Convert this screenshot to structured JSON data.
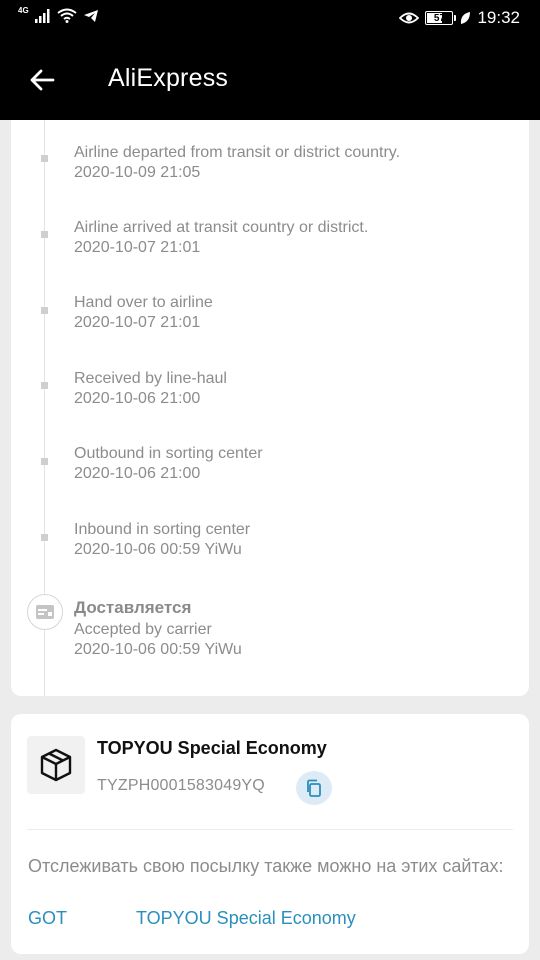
{
  "status_bar": {
    "network": "4G",
    "battery": "57",
    "time": "19:32"
  },
  "header": {
    "title": "AliExpress"
  },
  "tracking": {
    "events": [
      {
        "text": "Airline departed from transit or district country.",
        "date": "2020-10-09 21:05"
      },
      {
        "text": "Airline arrived at transit country or district.",
        "date": "2020-10-07 21:01"
      },
      {
        "text": "Hand over to airline",
        "date": "2020-10-07 21:01"
      },
      {
        "text": "Received by line-haul",
        "date": "2020-10-06 21:00"
      },
      {
        "text": "Outbound in sorting center",
        "date": "2020-10-06 21:00"
      },
      {
        "text": "Inbound in sorting center",
        "date": "2020-10-06 00:59 YiWu"
      }
    ],
    "status_event": {
      "status": "Доставляется",
      "text": "Accepted by carrier",
      "date": "2020-10-06 00:59 YiWu"
    }
  },
  "carrier": {
    "name": "TOPYOU Special Economy",
    "tracking_number": "TYZPH0001583049YQ",
    "info_text": "Отслеживать свою посылку также можно на этих сайтах:",
    "links": [
      "GOT",
      "TOPYOU Special Economy"
    ]
  },
  "icons": {
    "back": "arrow-left-icon",
    "package": "package-box-icon",
    "copy": "copy-icon",
    "status": "truck-card-icon"
  },
  "colors": {
    "link": "#2a8fbd",
    "copy_bg": "#dcebf5",
    "text_muted": "#8c8c8c"
  }
}
